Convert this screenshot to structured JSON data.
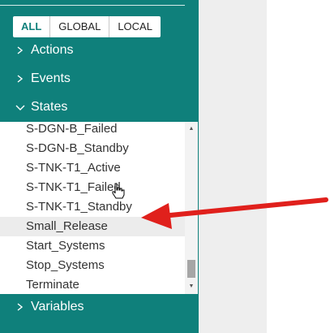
{
  "filters": {
    "all": "ALL",
    "global": "GLOBAL",
    "local": "LOCAL"
  },
  "sections": {
    "actions": "Actions",
    "events": "Events",
    "states": "States",
    "variables": "Variables"
  },
  "states": [
    "S-DGN-B_Failed",
    "S-DGN-B_Standby",
    "S-TNK-T1_Active",
    "S-TNK-T1_Failed",
    "S-TNK-T1_Standby",
    "Small_Release",
    "Start_Systems",
    "Stop_Systems",
    "Terminate"
  ],
  "scrollbar": {
    "up_glyph": "▲",
    "down_glyph": "▼"
  },
  "annotation": {
    "color": "#e0201c"
  }
}
